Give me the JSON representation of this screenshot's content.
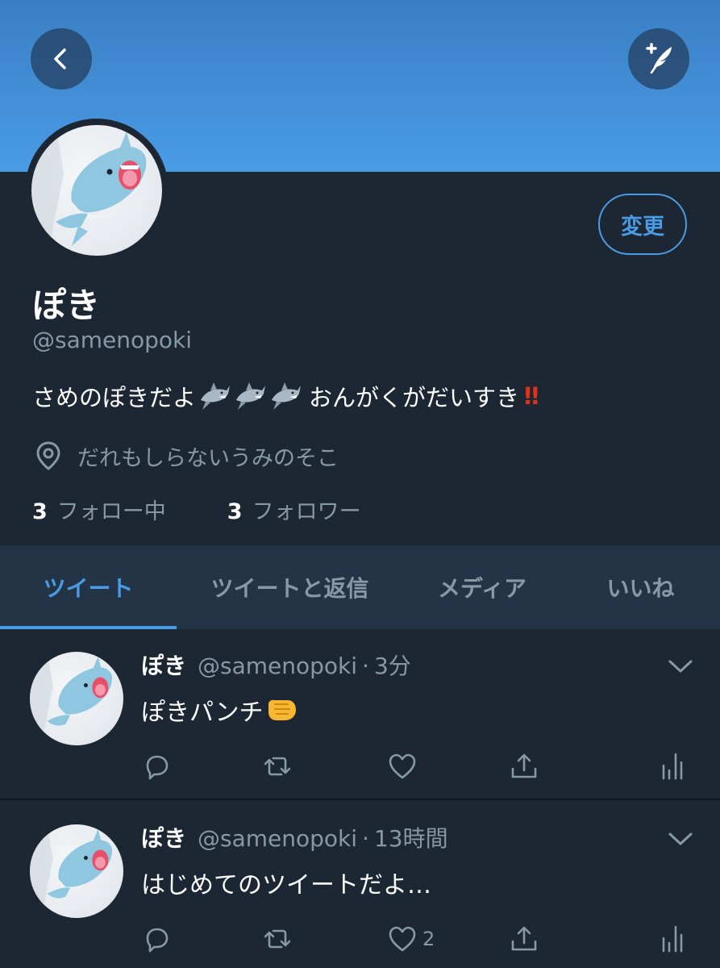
{
  "header": {
    "back_icon": "chevron-left-icon",
    "compose_icon": "compose-feather-icon"
  },
  "profile": {
    "change_label": "変更",
    "name": "ぽき",
    "handle": "@samenopoki",
    "bio_text": "さめのぽきだよ",
    "bio_emoji": "shark-emoji",
    "bio_text_2": "おんがくがだいすき",
    "bio_excl": "‼️",
    "location": "だれもしらないうみのそこ",
    "following_count": "3",
    "following_label": "フォロー中",
    "followers_count": "3",
    "followers_label": "フォロワー"
  },
  "tabs": [
    {
      "label": "ツイート",
      "active": true
    },
    {
      "label": "ツイートと返信",
      "active": false
    },
    {
      "label": "メディア",
      "active": false
    },
    {
      "label": "いいね",
      "active": false
    }
  ],
  "tweets": [
    {
      "name": "ぽき",
      "handle": "@samenopoki",
      "separator": "·",
      "time": "3分",
      "text": "ぽきパンチ",
      "text_emoji": "fist-emoji",
      "like_count": ""
    },
    {
      "name": "ぽき",
      "handle": "@samenopoki",
      "separator": "·",
      "time": "13時間",
      "text": "はじめてのツイートだよ…",
      "like_count": "2"
    }
  ],
  "colors": {
    "accent": "#4a9be6",
    "background": "#1c2733",
    "tab_bar": "#243447",
    "secondary_text": "#8899a6",
    "banner": "#4a9be6"
  }
}
